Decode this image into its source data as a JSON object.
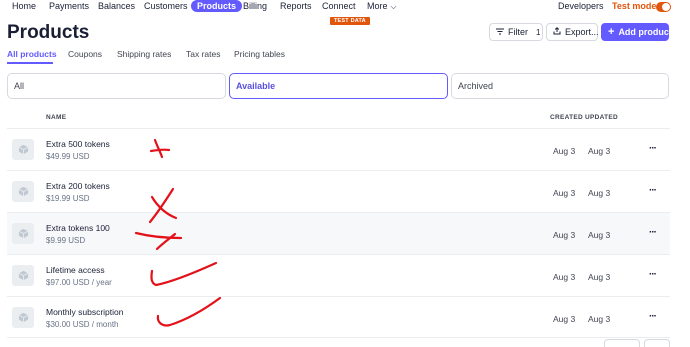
{
  "nav": {
    "items": [
      {
        "label": "Home"
      },
      {
        "label": "Payments"
      },
      {
        "label": "Balances"
      },
      {
        "label": "Customers"
      },
      {
        "label": "Products"
      },
      {
        "label": "Billing"
      },
      {
        "label": "Reports"
      },
      {
        "label": "Connect"
      },
      {
        "label": "More"
      }
    ],
    "active": "Products",
    "developers": "Developers",
    "test_mode": "Test mode",
    "test_mode_on": true,
    "test_data_badge": "TEST DATA"
  },
  "header": {
    "title": "Products",
    "filter_label": "Filter",
    "filter_count": "1",
    "export_label": "Export...",
    "add_label": "Add product"
  },
  "tabs": [
    "All products",
    "Coupons",
    "Shipping rates",
    "Tax rates",
    "Pricing tables"
  ],
  "active_tab": "All products",
  "filters": [
    "All",
    "Available",
    "Archived"
  ],
  "active_filter": "Available",
  "table": {
    "columns": {
      "name": "NAME",
      "created": "CREATED",
      "updated": "UPDATED"
    },
    "rows": [
      {
        "name": "Extra 500 tokens",
        "price": "$49.99 USD",
        "created": "Aug 3",
        "updated": "Aug 3",
        "annotation": "cross"
      },
      {
        "name": "Extra 200 tokens",
        "price": "$19.99 USD",
        "created": "Aug 3",
        "updated": "Aug 3",
        "annotation": "cross"
      },
      {
        "name": "Extra tokens 100",
        "price": "$9.99 USD",
        "created": "Aug 3",
        "updated": "Aug 3",
        "annotation": "cross"
      },
      {
        "name": "Lifetime access",
        "price": "$97.00 USD / year",
        "created": "Aug 3",
        "updated": "Aug 3",
        "annotation": "check"
      },
      {
        "name": "Monthly subscription",
        "price": "$30.00 USD / month",
        "created": "Aug 3",
        "updated": "Aug 3",
        "annotation": "check"
      }
    ]
  },
  "colors": {
    "accent": "#635bff",
    "test_mode": "#e2550c",
    "annotation": "#e3121a"
  },
  "icons": {
    "more": "chevron-down-icon",
    "export": "export-icon",
    "add": "plus-icon",
    "product_thumb": "product-box-icon",
    "row_menu": "ellipsis-icon"
  }
}
